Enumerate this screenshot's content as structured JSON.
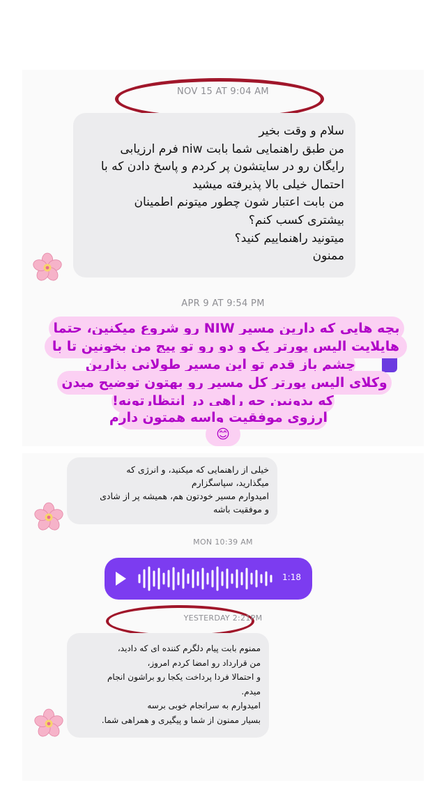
{
  "thread": {
    "timestamps": {
      "first": "NOV 15 AT 9:04 AM",
      "second": "APR 9 AT 9:54 PM",
      "third": "MON 10:39 AM",
      "fourth": "YESTERDAY 2:21PM"
    },
    "message_1": {
      "lines": [
        "سلام و وقت بخیر",
        "من طبق راهنمایی شما بابت niw فرم ارزیابی",
        "رایگان رو در سایتشون پر کردم و پاسخ دادن که با",
        "احتمال خیلی بالا پذیرفته میشید",
        "من بابت اعتبار شون چطور میتونم اطمینان",
        "بیشتری کسب کنم؟",
        "میتونید راهنماییم کنید؟",
        "ممنون"
      ]
    },
    "overlay_text": {
      "lines": [
        "بچه هایی که دارین مسیر NIW رو شروع میکنین، حتما",
        "هایلایت الیس پورتر یک و دو رو تو پیج من بخونین تا با",
        "چشم باز قدم تو این مسیر طولانی بذارین",
        "وکلای الیس پورتر کل مسیر رو بهتون توضیح میدن",
        "که بدونین چه راهی در انتظارتونه!",
        "ارزوی موفقیت واسه همتون دارم",
        "😊"
      ]
    },
    "message_3": {
      "lines": [
        "خیلی از راهنمایی که میکنید، و انرژی که",
        "میگذارید، سپاسگزارم",
        "امیدوارم مسیر خودتون هم، همیشه پر از شادی",
        "و موفقیت باشه"
      ]
    },
    "voice_message": {
      "duration": "1:18"
    },
    "message_5": {
      "lines": [
        "ممنوم بابت پیام دلگرم کننده ای که دادید،",
        "من قرارداد رو امضا کردم امروز،",
        "و احتمالا فردا پرداخت یکجا رو براشون انجام",
        "میدم.",
        "امیدوارم به سرانجام خوبی برسه",
        "بسیار ممنون از شما و پیگیری و همراهی شما."
      ]
    }
  },
  "colors": {
    "bubble_bg": "#ececee",
    "highlight_bg": "#fbd0f3",
    "highlight_text": "#b000c8",
    "voice_bg": "#7c3cf0",
    "circle_marker": "#a0162a"
  },
  "icons": {
    "avatar": "cherry-blossom-icon",
    "play": "play-icon",
    "waveform": "waveform-icon"
  }
}
